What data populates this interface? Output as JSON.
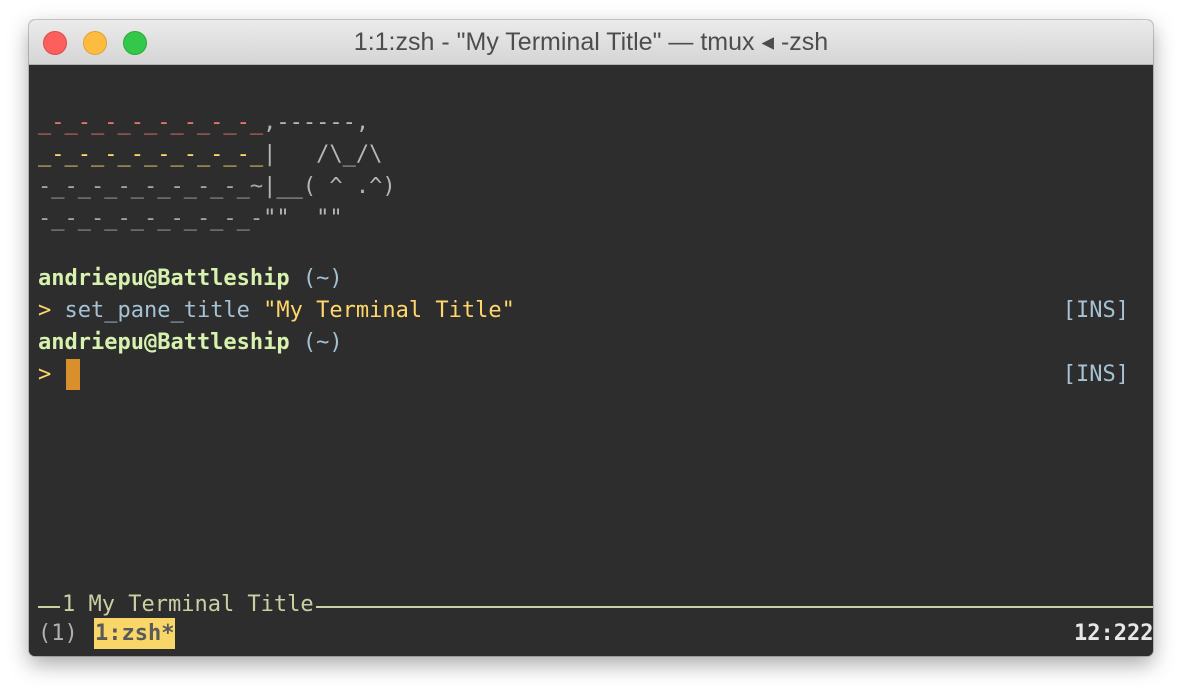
{
  "window": {
    "title": "1:1:zsh - \"My Terminal Title\"  — tmux ◂ -zsh"
  },
  "terminal": {
    "art": {
      "line1_trail": "_-_-_-_-_-_-_-_-_",
      "line1_cat": ",------,",
      "line2_trail": "_-_-_-_-_-_-_-_-_",
      "line2_cat": "|   /\\_/\\",
      "line3_trail": "-_-_-_-_-_-_-_-_~",
      "line3_cat": "|__( ^ .^)",
      "line4_trail": "-_-_-_-_-_-_-_-_-",
      "line4_cat": "\"\"  \"\""
    },
    "lines": [
      {
        "user_host": "andriepu@Battleship",
        "dir": " (~)"
      },
      {
        "prompt": ">",
        "command": " set_pane_title ",
        "argument": "\"My Terminal Title\"",
        "mode": "[INS]"
      },
      {
        "user_host": "andriepu@Battleship",
        "dir": " (~)"
      },
      {
        "prompt": ">",
        "mode": "[INS]"
      }
    ]
  },
  "tmux": {
    "pane_title": "1 My Terminal Title",
    "status_session": "(1)",
    "status_window": "1:zsh*",
    "status_clock": "12:222"
  },
  "colors": {
    "terminal_bg": "#2d2d2d",
    "accent_yellow": "#ffd76b",
    "accent_green": "#d6f2ae",
    "cursor": "#d88f2c",
    "status_highlight": "#f8d668"
  }
}
